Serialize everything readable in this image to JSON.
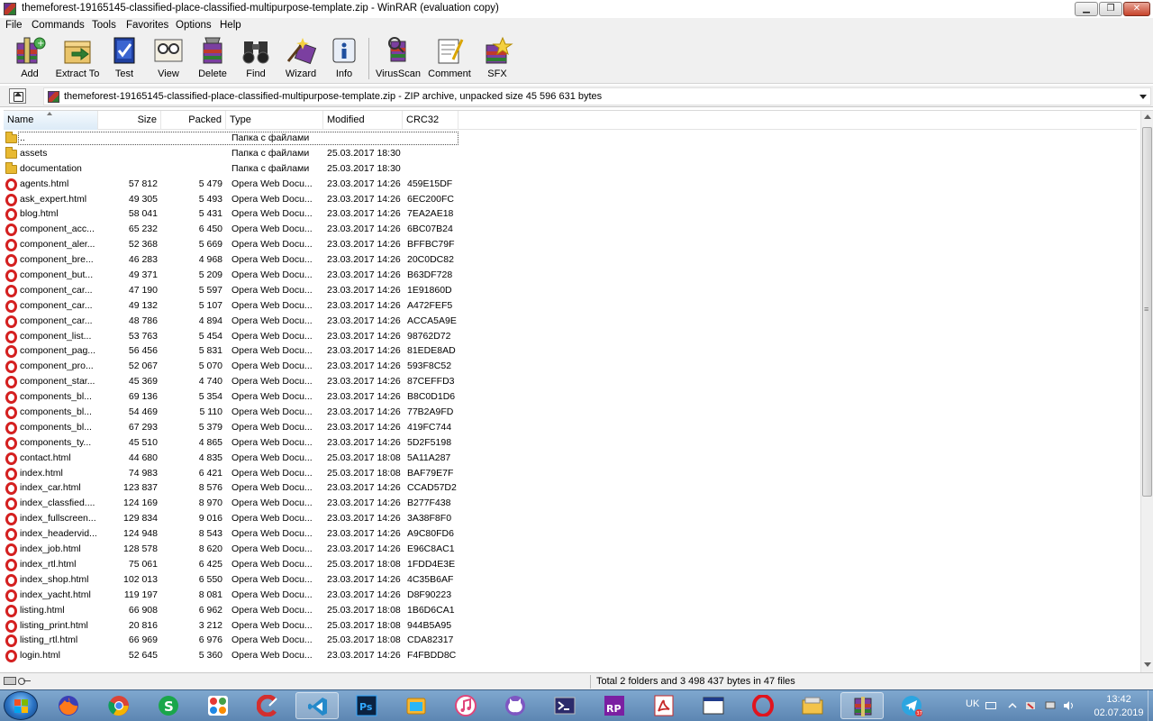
{
  "window": {
    "title": "themeforest-19165145-classified-place-classified-multipurpose-template.zip - WinRAR (evaluation copy)"
  },
  "menu": [
    {
      "label": "File"
    },
    {
      "label": "Commands"
    },
    {
      "label": "Tools"
    },
    {
      "label": "Favorites"
    },
    {
      "label": "Options"
    },
    {
      "label": "Help"
    }
  ],
  "toolbar": [
    {
      "label": "Add",
      "icon": "add-archive-icon"
    },
    {
      "label": "Extract To",
      "icon": "extract-to-icon"
    },
    {
      "label": "Test",
      "icon": "test-icon"
    },
    {
      "label": "View",
      "icon": "view-icon"
    },
    {
      "label": "Delete",
      "icon": "delete-icon"
    },
    {
      "label": "Find",
      "icon": "find-binoculars-icon"
    },
    {
      "label": "Wizard",
      "icon": "wizard-icon"
    },
    {
      "label": "Info",
      "icon": "info-icon"
    },
    {
      "label": "VirusScan",
      "icon": "virusscan-icon"
    },
    {
      "label": "Comment",
      "icon": "comment-icon"
    },
    {
      "label": "SFX",
      "icon": "sfx-icon"
    }
  ],
  "pathbar": {
    "text": "themeforest-19165145-classified-place-classified-multipurpose-template.zip - ZIP archive, unpacked size 45 596 631 bytes"
  },
  "columns": {
    "name": "Name",
    "size": "Size",
    "packed": "Packed",
    "type": "Type",
    "modified": "Modified",
    "crc": "CRC32"
  },
  "files": [
    {
      "icon": "folder",
      "name": "..",
      "size": "",
      "packed": "",
      "type": "Папка с файлами",
      "modified": "",
      "crc": ""
    },
    {
      "icon": "folder",
      "name": "assets",
      "size": "",
      "packed": "",
      "type": "Папка с файлами",
      "modified": "25.03.2017 18:30",
      "crc": ""
    },
    {
      "icon": "folder",
      "name": "documentation",
      "size": "",
      "packed": "",
      "type": "Папка с файлами",
      "modified": "25.03.2017 18:30",
      "crc": ""
    },
    {
      "icon": "opera",
      "name": "agents.html",
      "size": "57 812",
      "packed": "5 479",
      "type": "Opera Web Docu...",
      "modified": "23.03.2017 14:26",
      "crc": "459E15DF"
    },
    {
      "icon": "opera",
      "name": "ask_expert.html",
      "size": "49 305",
      "packed": "5 493",
      "type": "Opera Web Docu...",
      "modified": "23.03.2017 14:26",
      "crc": "6EC200FC"
    },
    {
      "icon": "opera",
      "name": "blog.html",
      "size": "58 041",
      "packed": "5 431",
      "type": "Opera Web Docu...",
      "modified": "23.03.2017 14:26",
      "crc": "7EA2AE18"
    },
    {
      "icon": "opera",
      "name": "component_acc...",
      "size": "65 232",
      "packed": "6 450",
      "type": "Opera Web Docu...",
      "modified": "23.03.2017 14:26",
      "crc": "6BC07B24"
    },
    {
      "icon": "opera",
      "name": "component_aler...",
      "size": "52 368",
      "packed": "5 669",
      "type": "Opera Web Docu...",
      "modified": "23.03.2017 14:26",
      "crc": "BFFBC79F"
    },
    {
      "icon": "opera",
      "name": "component_bre...",
      "size": "46 283",
      "packed": "4 968",
      "type": "Opera Web Docu...",
      "modified": "23.03.2017 14:26",
      "crc": "20C0DC82"
    },
    {
      "icon": "opera",
      "name": "component_but...",
      "size": "49 371",
      "packed": "5 209",
      "type": "Opera Web Docu...",
      "modified": "23.03.2017 14:26",
      "crc": "B63DF728"
    },
    {
      "icon": "opera",
      "name": "component_car...",
      "size": "47 190",
      "packed": "5 597",
      "type": "Opera Web Docu...",
      "modified": "23.03.2017 14:26",
      "crc": "1E91860D"
    },
    {
      "icon": "opera",
      "name": "component_car...",
      "size": "49 132",
      "packed": "5 107",
      "type": "Opera Web Docu...",
      "modified": "23.03.2017 14:26",
      "crc": "A472FEF5"
    },
    {
      "icon": "opera",
      "name": "component_car...",
      "size": "48 786",
      "packed": "4 894",
      "type": "Opera Web Docu...",
      "modified": "23.03.2017 14:26",
      "crc": "ACCA5A9E"
    },
    {
      "icon": "opera",
      "name": "component_list...",
      "size": "53 763",
      "packed": "5 454",
      "type": "Opera Web Docu...",
      "modified": "23.03.2017 14:26",
      "crc": "98762D72"
    },
    {
      "icon": "opera",
      "name": "component_pag...",
      "size": "56 456",
      "packed": "5 831",
      "type": "Opera Web Docu...",
      "modified": "23.03.2017 14:26",
      "crc": "81EDE8AD"
    },
    {
      "icon": "opera",
      "name": "component_pro...",
      "size": "52 067",
      "packed": "5 070",
      "type": "Opera Web Docu...",
      "modified": "23.03.2017 14:26",
      "crc": "593F8C52"
    },
    {
      "icon": "opera",
      "name": "component_star...",
      "size": "45 369",
      "packed": "4 740",
      "type": "Opera Web Docu...",
      "modified": "23.03.2017 14:26",
      "crc": "87CEFFD3"
    },
    {
      "icon": "opera",
      "name": "components_bl...",
      "size": "69 136",
      "packed": "5 354",
      "type": "Opera Web Docu...",
      "modified": "23.03.2017 14:26",
      "crc": "B8C0D1D6"
    },
    {
      "icon": "opera",
      "name": "components_bl...",
      "size": "54 469",
      "packed": "5 110",
      "type": "Opera Web Docu...",
      "modified": "23.03.2017 14:26",
      "crc": "77B2A9FD"
    },
    {
      "icon": "opera",
      "name": "components_bl...",
      "size": "67 293",
      "packed": "5 379",
      "type": "Opera Web Docu...",
      "modified": "23.03.2017 14:26",
      "crc": "419FC744"
    },
    {
      "icon": "opera",
      "name": "components_ty...",
      "size": "45 510",
      "packed": "4 865",
      "type": "Opera Web Docu...",
      "modified": "23.03.2017 14:26",
      "crc": "5D2F5198"
    },
    {
      "icon": "opera",
      "name": "contact.html",
      "size": "44 680",
      "packed": "4 835",
      "type": "Opera Web Docu...",
      "modified": "25.03.2017 18:08",
      "crc": "5A11A287"
    },
    {
      "icon": "opera",
      "name": "index.html",
      "size": "74 983",
      "packed": "6 421",
      "type": "Opera Web Docu...",
      "modified": "25.03.2017 18:08",
      "crc": "BAF79E7F"
    },
    {
      "icon": "opera",
      "name": "index_car.html",
      "size": "123 837",
      "packed": "8 576",
      "type": "Opera Web Docu...",
      "modified": "23.03.2017 14:26",
      "crc": "CCAD57D2"
    },
    {
      "icon": "opera",
      "name": "index_classfied....",
      "size": "124 169",
      "packed": "8 970",
      "type": "Opera Web Docu...",
      "modified": "23.03.2017 14:26",
      "crc": "B277F438"
    },
    {
      "icon": "opera",
      "name": "index_fullscreen...",
      "size": "129 834",
      "packed": "9 016",
      "type": "Opera Web Docu...",
      "modified": "23.03.2017 14:26",
      "crc": "3A38F8F0"
    },
    {
      "icon": "opera",
      "name": "index_headervid...",
      "size": "124 948",
      "packed": "8 543",
      "type": "Opera Web Docu...",
      "modified": "23.03.2017 14:26",
      "crc": "A9C80FD6"
    },
    {
      "icon": "opera",
      "name": "index_job.html",
      "size": "128 578",
      "packed": "8 620",
      "type": "Opera Web Docu...",
      "modified": "23.03.2017 14:26",
      "crc": "E96C8AC1"
    },
    {
      "icon": "opera",
      "name": "index_rtl.html",
      "size": "75 061",
      "packed": "6 425",
      "type": "Opera Web Docu...",
      "modified": "25.03.2017 18:08",
      "crc": "1FDD4E3E"
    },
    {
      "icon": "opera",
      "name": "index_shop.html",
      "size": "102 013",
      "packed": "6 550",
      "type": "Opera Web Docu...",
      "modified": "23.03.2017 14:26",
      "crc": "4C35B6AF"
    },
    {
      "icon": "opera",
      "name": "index_yacht.html",
      "size": "119 197",
      "packed": "8 081",
      "type": "Opera Web Docu...",
      "modified": "23.03.2017 14:26",
      "crc": "D8F90223"
    },
    {
      "icon": "opera",
      "name": "listing.html",
      "size": "66 908",
      "packed": "6 962",
      "type": "Opera Web Docu...",
      "modified": "25.03.2017 18:08",
      "crc": "1B6D6CA1"
    },
    {
      "icon": "opera",
      "name": "listing_print.html",
      "size": "20 816",
      "packed": "3 212",
      "type": "Opera Web Docu...",
      "modified": "25.03.2017 18:08",
      "crc": "944B5A95"
    },
    {
      "icon": "opera",
      "name": "listing_rtl.html",
      "size": "66 969",
      "packed": "6 976",
      "type": "Opera Web Docu...",
      "modified": "25.03.2017 18:08",
      "crc": "CDA82317"
    },
    {
      "icon": "opera",
      "name": "login.html",
      "size": "52 645",
      "packed": "5 360",
      "type": "Opera Web Docu...",
      "modified": "23.03.2017 14:26",
      "crc": "F4FBDD8C"
    }
  ],
  "status": {
    "total": "Total 2 folders and 3 498 437 bytes in 47 files"
  },
  "taskbar": {
    "apps": [
      {
        "icon": "firefox-icon"
      },
      {
        "icon": "chrome-icon"
      },
      {
        "icon": "skype-icon"
      },
      {
        "icon": "office-tab-icon"
      },
      {
        "icon": "ccleaner-icon"
      },
      {
        "icon": "vscode-icon"
      },
      {
        "icon": "photoshop-icon"
      },
      {
        "icon": "file-manager-icon"
      },
      {
        "icon": "itunes-icon"
      },
      {
        "icon": "github-desktop-icon"
      },
      {
        "icon": "powershell-icon"
      },
      {
        "icon": "rp-icon"
      },
      {
        "icon": "acrobat-icon"
      },
      {
        "icon": "window-icon"
      },
      {
        "icon": "opera-icon"
      },
      {
        "icon": "explorer-icon"
      },
      {
        "icon": "winrar-icon"
      },
      {
        "icon": "telegram-icon"
      }
    ],
    "rp_label": "RP",
    "ps_label": "Ps",
    "telegram_badge": "37",
    "lang": "UK",
    "time": "13:42",
    "date": "02.07.2019"
  },
  "colors": {
    "opera_red": "#d42020",
    "folder_yellow": "#e8b931",
    "taskbar_blue": "#6d97c2"
  }
}
